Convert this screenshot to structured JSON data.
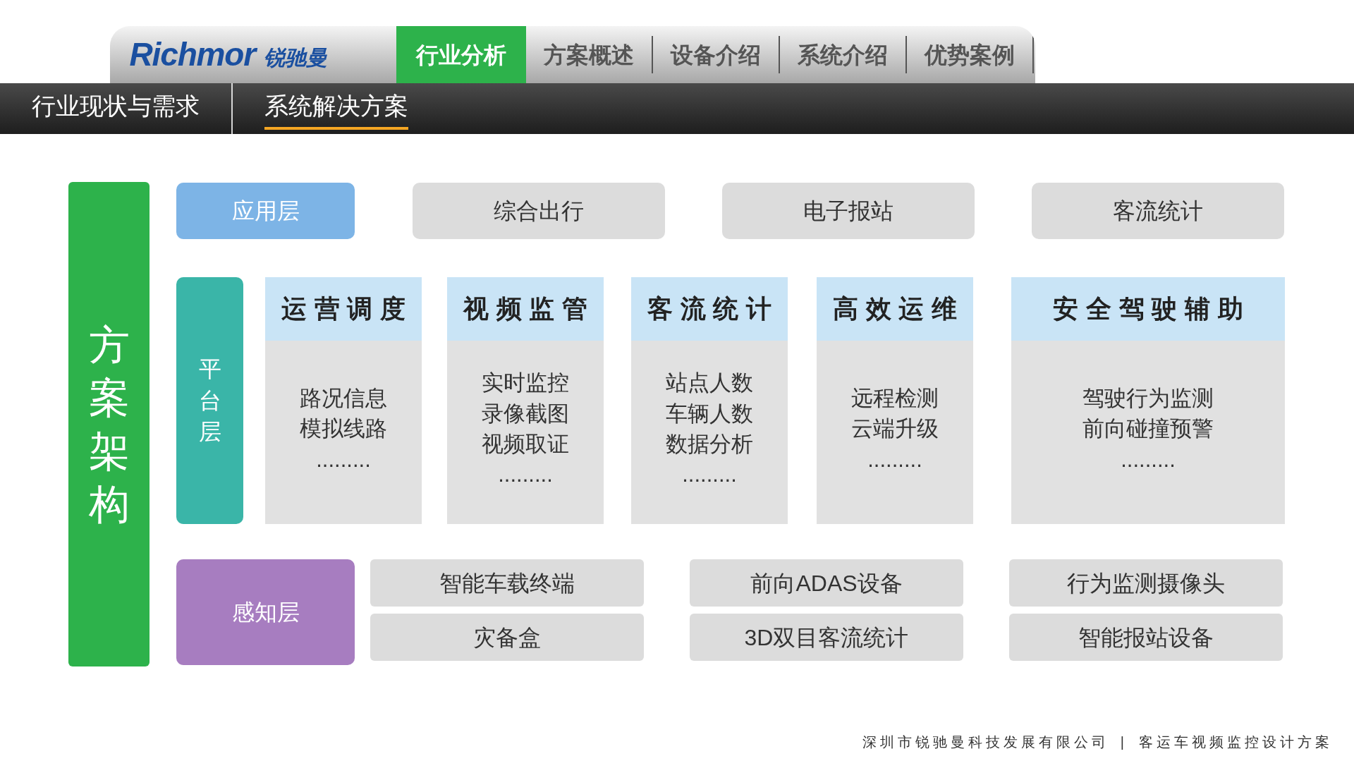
{
  "header": {
    "logo": {
      "brand": "Richmor",
      "brand_cn": "锐驰曼"
    },
    "tabs": [
      {
        "label": "行业分析",
        "selected": true
      },
      {
        "label": "方案概述",
        "selected": false
      },
      {
        "label": "设备介绍",
        "selected": false
      },
      {
        "label": "系统介绍",
        "selected": false
      },
      {
        "label": "优势案例",
        "selected": false
      }
    ]
  },
  "subnav": [
    {
      "label": "行业现状与需求",
      "selected": false
    },
    {
      "label": "系统解决方案",
      "selected": true
    }
  ],
  "architecture": {
    "title": "方案架构",
    "application_layer": {
      "label": "应用层",
      "items": [
        "综合出行",
        "电子报站",
        "客流统计"
      ]
    },
    "platform_layer": {
      "label": "平台层",
      "modules": [
        {
          "title": "运营调度",
          "lines": [
            "路况信息",
            "模拟线路",
            "........."
          ]
        },
        {
          "title": "视频监管",
          "lines": [
            "实时监控",
            "录像截图",
            "视频取证",
            "........."
          ]
        },
        {
          "title": "客流统计",
          "lines": [
            "站点人数",
            "车辆人数",
            "数据分析",
            "........."
          ]
        },
        {
          "title": "高效运维",
          "lines": [
            "远程检测",
            "云端升级",
            "........."
          ]
        },
        {
          "title": "安全驾驶辅助",
          "lines": [
            "驾驶行为监测",
            "前向碰撞预警",
            "........."
          ]
        }
      ]
    },
    "perception_layer": {
      "label": "感知层",
      "items": [
        [
          "智能车载终端",
          "灾备盒"
        ],
        [
          "前向ADAS设备",
          "3D双目客流统计"
        ],
        [
          "行为监测摄像头",
          "智能报站设备"
        ]
      ]
    }
  },
  "footer": {
    "company": "深圳市锐驰曼科技发展有限公司",
    "separator": "|",
    "document": "客运车视频监控设计方案"
  }
}
